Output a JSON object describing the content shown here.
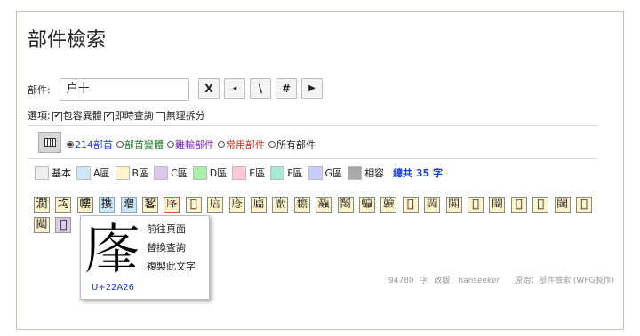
{
  "title": "部件檢索",
  "search": {
    "label": "部件:",
    "value": "户十"
  },
  "buttons": [
    "X",
    "◂",
    "\\",
    "#",
    "▶"
  ],
  "options": {
    "label": "選項:",
    "items": [
      {
        "label": "包容異體",
        "checked": true
      },
      {
        "label": "即時查詢",
        "checked": true
      },
      {
        "label": "無理拆分",
        "checked": false
      }
    ]
  },
  "radicals": {
    "items": [
      {
        "label": "214部首",
        "selected": true,
        "color": "#1a3dd1"
      },
      {
        "label": "部首變體",
        "selected": false,
        "color": "#1c7a28"
      },
      {
        "label": "難輸部件",
        "selected": false,
        "color": "#8a2ab8"
      },
      {
        "label": "常用部件",
        "selected": false,
        "color": "#c0321c"
      },
      {
        "label": "所有部件",
        "selected": false,
        "color": "#222222"
      }
    ]
  },
  "legend": {
    "items": [
      {
        "label": "基本",
        "color": "#eeeeee"
      },
      {
        "label": "A區",
        "color": "#cfe6f7"
      },
      {
        "label": "B區",
        "color": "#fff5cc"
      },
      {
        "label": "C區",
        "color": "#dcc9ea"
      },
      {
        "label": "D區",
        "color": "#a8f0a8"
      },
      {
        "label": "E區",
        "color": "#ffc8d4"
      },
      {
        "label": "F區",
        "color": "#a8ead8"
      },
      {
        "label": "G區",
        "color": "#c8ccf8"
      },
      {
        "label": "相容",
        "color": "#aaaaaa"
      }
    ],
    "total": "總共 35 字"
  },
  "results": [
    {
      "char": "㵎",
      "kind": "y"
    },
    {
      "char": "㘬",
      "kind": "y"
    },
    {
      "char": "㡞",
      "kind": "y"
    },
    {
      "char": "㨦",
      "kind": "b"
    },
    {
      "char": "㬝",
      "kind": "b"
    },
    {
      "char": "㗉",
      "kind": "y"
    },
    {
      "char": "𢈦",
      "kind": "sel"
    },
    {
      "char": "𢈧",
      "kind": "y"
    },
    {
      "char": "𢉩",
      "kind": "y"
    },
    {
      "char": "𢈸",
      "kind": "y"
    },
    {
      "char": "𢉞",
      "kind": "y"
    },
    {
      "char": "𢊰",
      "kind": "y"
    },
    {
      "char": "𣠳",
      "kind": "y"
    },
    {
      "char": "𤅴",
      "kind": "y"
    },
    {
      "char": "𦡼",
      "kind": "y"
    },
    {
      "char": "𧕳",
      "kind": "y"
    },
    {
      "char": "𩏩",
      "kind": "y"
    },
    {
      "char": "𨮁",
      "kind": "y"
    },
    {
      "char": "𨳵",
      "kind": "y"
    },
    {
      "char": "𨵗",
      "kind": "y"
    },
    {
      "char": "𨶐",
      "kind": "y"
    },
    {
      "char": "𨷆",
      "kind": "y"
    },
    {
      "char": "𨶚",
      "kind": "y"
    },
    {
      "char": "𨶩",
      "kind": "y"
    },
    {
      "char": "𨷃",
      "kind": "y"
    },
    {
      "char": "𨷌",
      "kind": "y"
    },
    {
      "char": "𨷐",
      "kind": "y"
    },
    {
      "char": "𥏦",
      "kind": "p"
    }
  ],
  "popup": {
    "char": "𢈦",
    "code": "U+22A26",
    "menu": [
      "前往頁面",
      "替換查詢",
      "複製此文字"
    ]
  },
  "footer": {
    "count": "94780",
    "unit": "字",
    "edition": "改版：hanseeker",
    "source": "原始：部件檢索 (WFG製作)"
  }
}
